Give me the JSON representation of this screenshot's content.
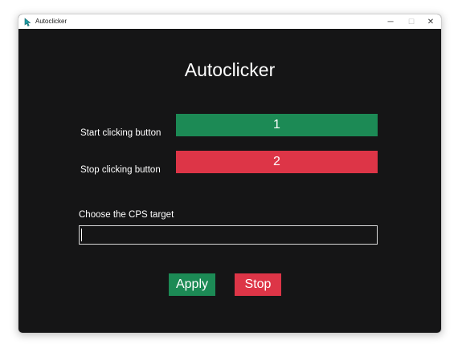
{
  "window": {
    "title": "Autoclicker",
    "controls": {
      "minimize": "─",
      "maximize": "☐",
      "close": "✕"
    }
  },
  "main": {
    "heading": "Autoclicker",
    "start": {
      "label": "Start clicking button",
      "key": "1"
    },
    "stop": {
      "label": "Stop clicking button",
      "key": "2"
    },
    "cps": {
      "label": "Choose the CPS target",
      "value": ""
    },
    "buttons": {
      "apply": "Apply",
      "stop": "Stop"
    }
  },
  "colors": {
    "background": "#151516",
    "green": "#1c8a55",
    "red": "#dd3547",
    "text": "#ffffff"
  },
  "icons": {
    "app": "cursor-icon"
  }
}
